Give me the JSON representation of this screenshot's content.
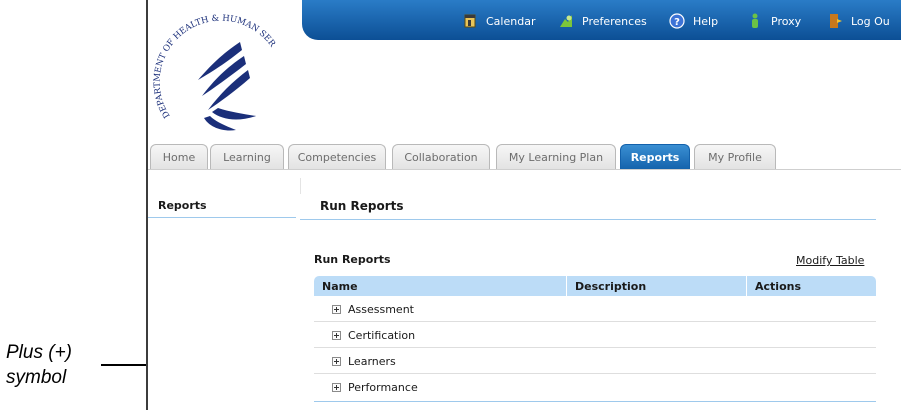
{
  "callout": {
    "line1": "Plus (+)",
    "line2": "symbol"
  },
  "topnav": {
    "items": [
      {
        "label": "Calendar",
        "icon": "calendar-icon"
      },
      {
        "label": "Preferences",
        "icon": "preferences-icon"
      },
      {
        "label": "Help",
        "icon": "help-icon"
      },
      {
        "label": "Proxy",
        "icon": "proxy-icon"
      },
      {
        "label": "Log Ou",
        "icon": "logout-icon"
      }
    ]
  },
  "logo": {
    "text": "DEPARTMENT OF HEALTH & HUMAN SERVICES · USA",
    "icon": "hhs-eagle-logo"
  },
  "tabs": [
    {
      "label": "Home"
    },
    {
      "label": "Learning"
    },
    {
      "label": "Competencies"
    },
    {
      "label": "Collaboration"
    },
    {
      "label": "My Learning Plan"
    },
    {
      "label": "Reports",
      "active": true
    },
    {
      "label": "My Profile"
    }
  ],
  "left_panel": {
    "title": "Reports"
  },
  "main": {
    "title": "Run Reports",
    "table_caption": "Run Reports",
    "modify_link": "Modify Table",
    "columns": [
      "Name",
      "Description",
      "Actions"
    ],
    "rows": [
      {
        "name": "Assessment"
      },
      {
        "name": "Certification"
      },
      {
        "name": "Learners"
      },
      {
        "name": "Performance"
      }
    ]
  },
  "colors": {
    "accent": "#1361ab",
    "header_blue": "#bcdcf7",
    "divider_blue": "#9ec9ec"
  }
}
